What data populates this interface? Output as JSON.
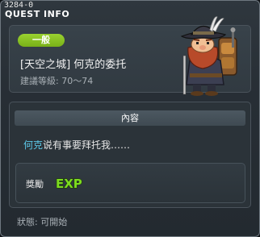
{
  "window": {
    "quest_id": "3284-0",
    "title": "QUEST INFO",
    "close_icon": "close-icon"
  },
  "header": {
    "category": "一般",
    "quest_name": "[天空之城] 何克的委托",
    "level_range": "建議等級: 70～74",
    "npc_portrait_icon": "npc-hoke-portrait"
  },
  "content": {
    "header_label": "內容",
    "npc_name": "何克",
    "description_rest": "说有事要拜托我……",
    "reward_label": "獎勵",
    "reward_icon": "exp-icon",
    "reward_text": "EXP"
  },
  "status": {
    "text": "狀態: 可開始"
  },
  "colors": {
    "badge_green": "#8cc425",
    "npc_link": "#5cc8e8",
    "exp_green": "#7ddc1f"
  }
}
